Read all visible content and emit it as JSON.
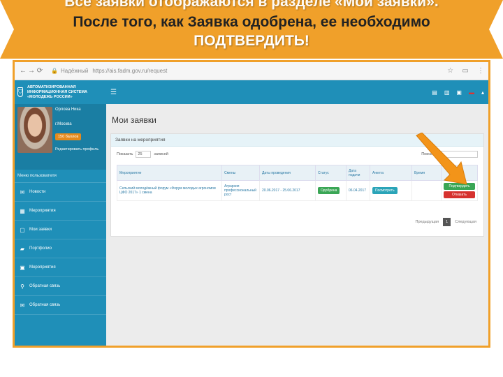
{
  "banner": {
    "line1": "Все заявки отображаются в разделе «Мои заявки».",
    "line2": "После того, как Заявка одобрена, ее необходимо",
    "line3": "ПОДТВЕРДИТЬ!"
  },
  "browser": {
    "url_secure": "Надёжный",
    "url": "https://ais.fadm.gov.ru/request"
  },
  "sidebar": {
    "logo_text": "АВТОМАТИЗИРОВАННАЯ ИНФОРМАЦИОННАЯ СИСТЕМА «МОЛОДЕЖЬ РОССИИ»",
    "profile": {
      "name": "Орлова Ника",
      "city": "г.Москва",
      "points": "150 баллов",
      "edit_link": "Редактировать профиль"
    },
    "menu_title": "Меню пользователя",
    "items": [
      {
        "label": "Новости",
        "icon": "megaphone-icon",
        "glyph": "✉"
      },
      {
        "label": "Мероприятия",
        "icon": "calendar-icon",
        "glyph": "▦"
      },
      {
        "label": "Мои заявки",
        "icon": "document-icon",
        "glyph": "▢"
      },
      {
        "label": "Портфолио",
        "icon": "folder-icon",
        "glyph": "▰"
      },
      {
        "label": "Мероприятия",
        "icon": "briefcase-icon",
        "glyph": "▣"
      },
      {
        "label": "Обратная связь",
        "icon": "pin-icon",
        "glyph": "⚲"
      },
      {
        "label": "Обратная связь",
        "icon": "mail-icon",
        "glyph": "✉"
      }
    ]
  },
  "topbar": {
    "menu_icon": "☰"
  },
  "main": {
    "title": "Мои заявки",
    "panel_title": "Заявки на мероприятия",
    "show_label": "Показать",
    "show_value": "25",
    "entries_label": "записей",
    "search_label": "Поиск:",
    "columns": [
      "Мероприятие",
      "Смены",
      "Даты проведения",
      "Статус",
      "Дата подачи",
      "Анкета",
      "Время",
      ""
    ],
    "row": {
      "event": "Сельский молодёжный форум «Форум молодых агрономов ЦФО 2017» 1 смена",
      "shift": "Агрархия профессиональный рост",
      "dates": "20.06.2017 - 25.06.2017",
      "status": "Одобрена",
      "submitted": "06.04.2017",
      "form_button": "Посмотреть",
      "time": "",
      "confirm_button": "Подтвердить",
      "reject_button": "Отказать"
    },
    "pager": {
      "prev": "Предыдущая",
      "current": "1",
      "next": "Следующая"
    }
  },
  "colors": {
    "banner": "#f0a02a",
    "sidebar": "#1f8fb8",
    "arrow": "#f39419"
  }
}
